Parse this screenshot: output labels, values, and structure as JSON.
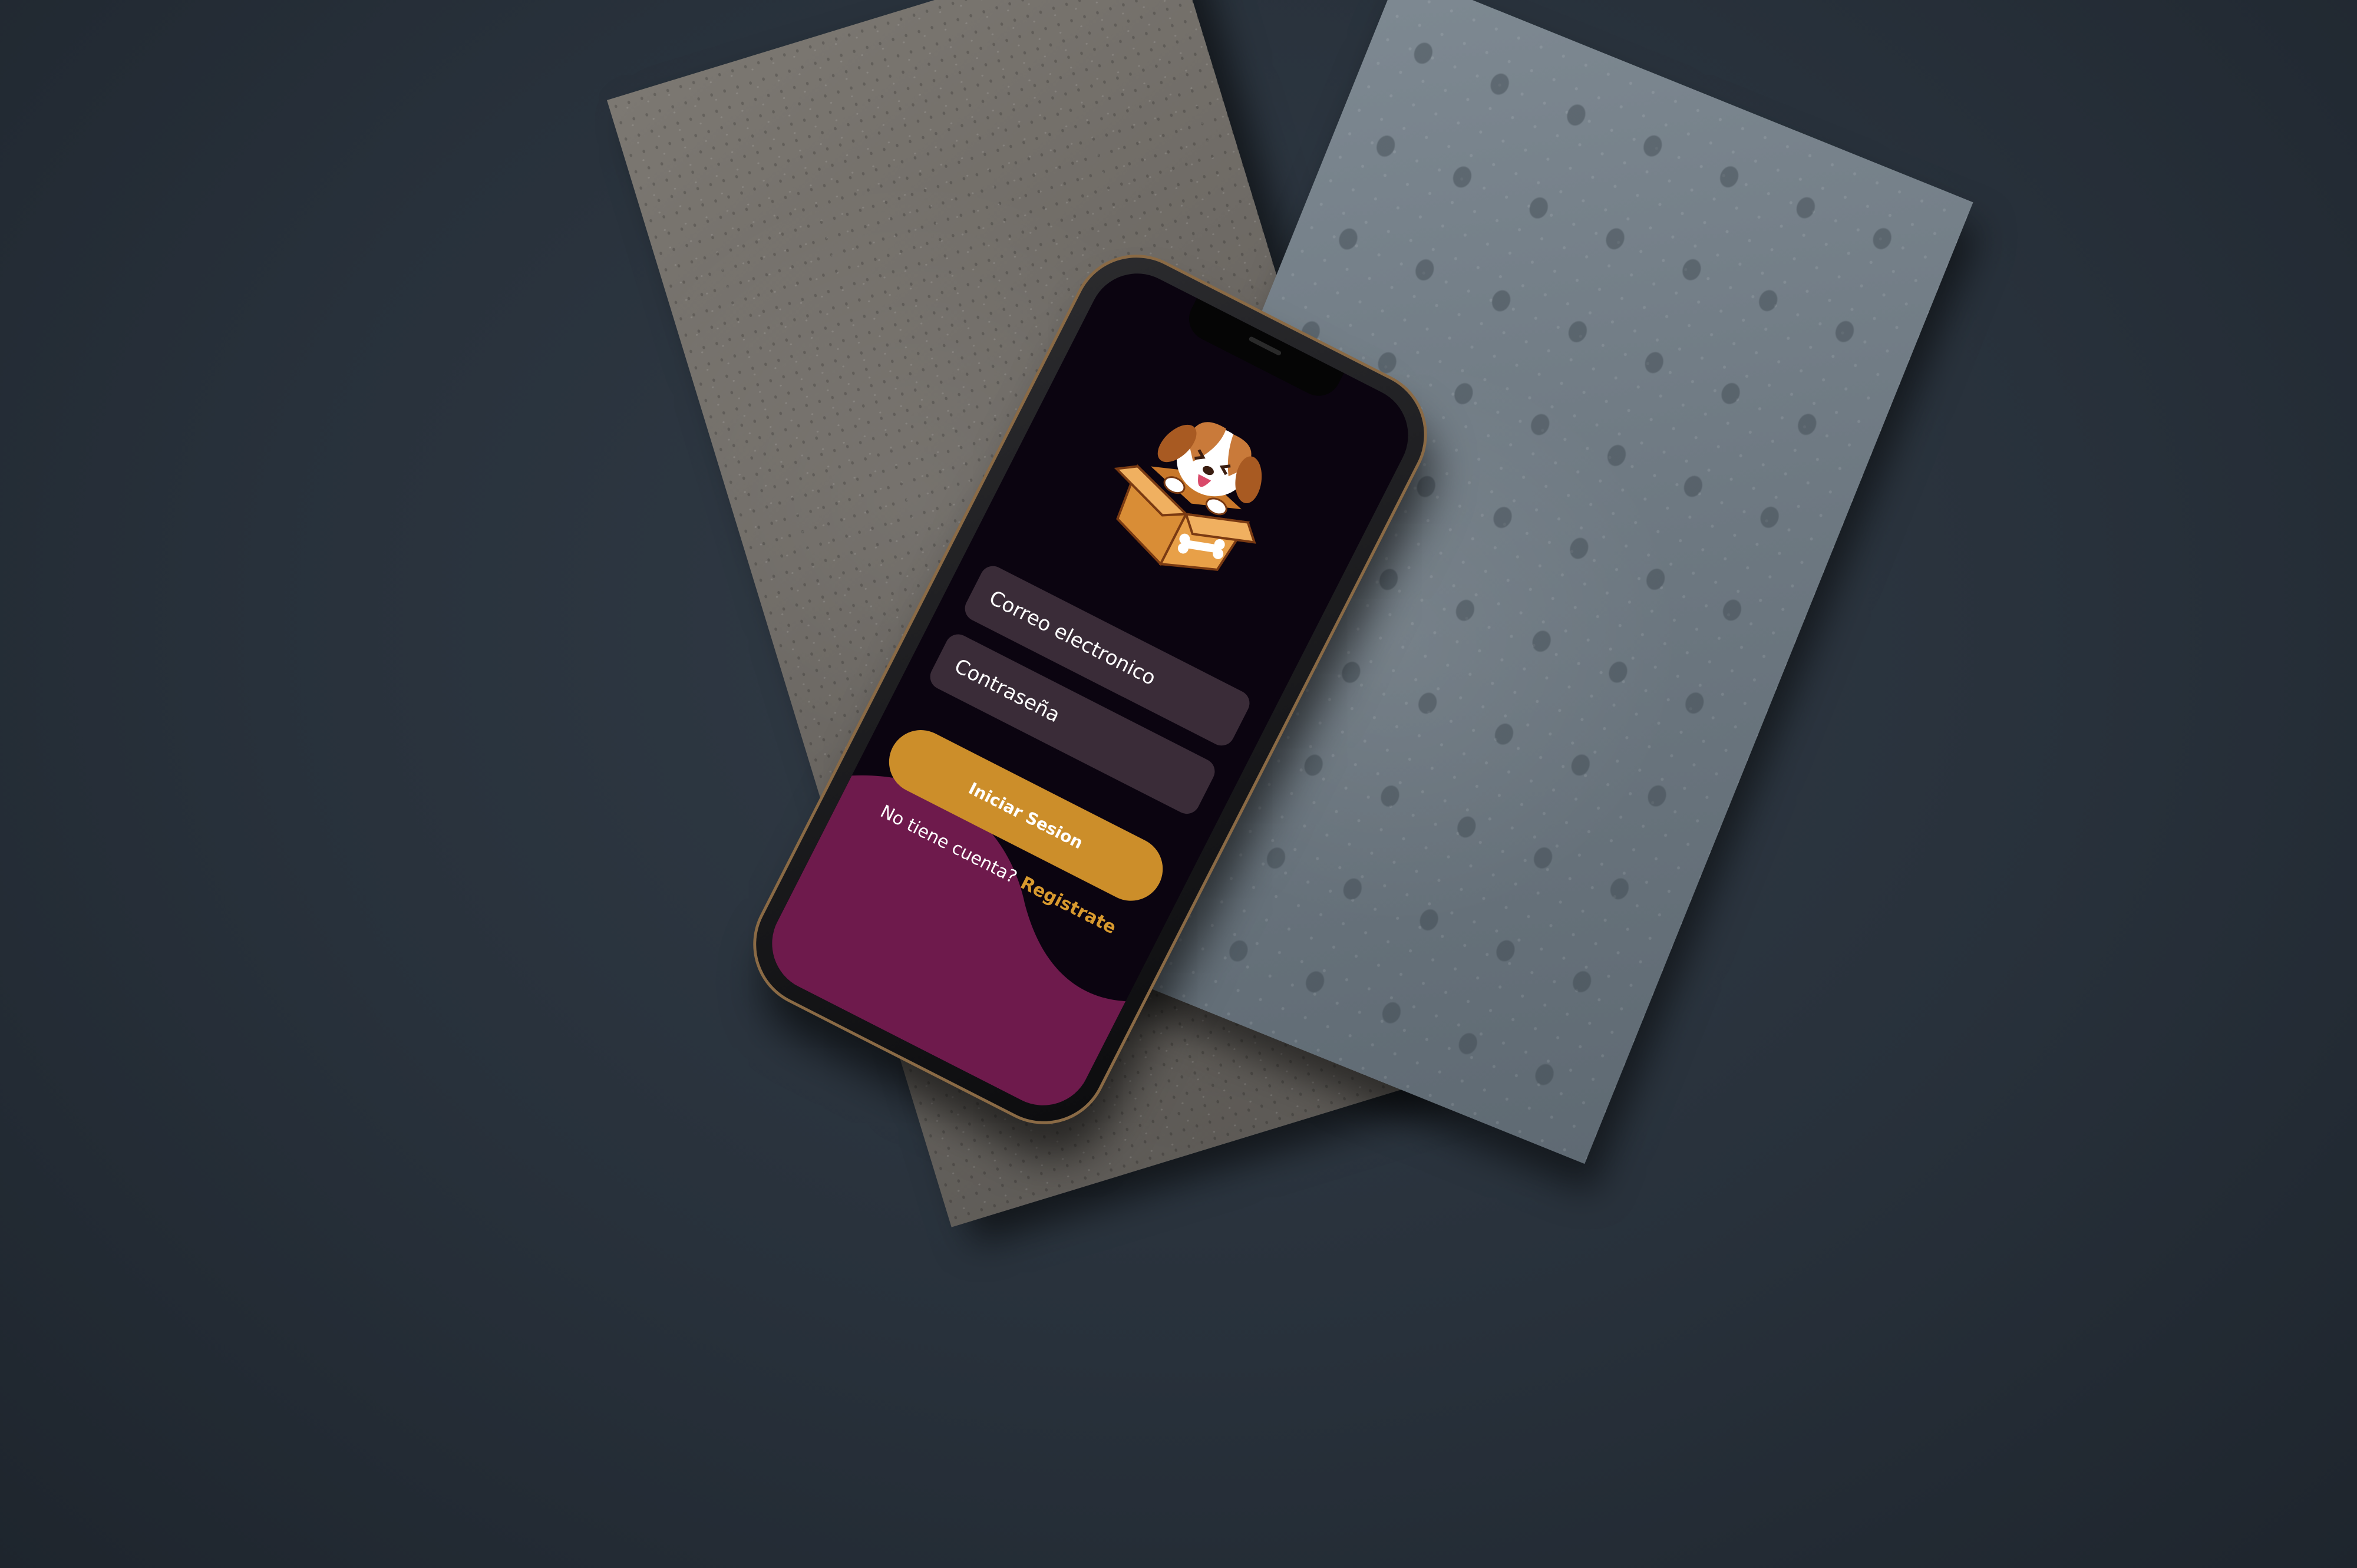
{
  "login": {
    "email_placeholder": "Correo electronico",
    "password_placeholder": "Contraseña",
    "submit_label": "Iniciar Sesion",
    "no_account_text": "No tiene cuenta?",
    "register_link": "Registrate"
  },
  "logo": {
    "icon": "puppy-in-box-icon"
  },
  "colors": {
    "screen_background": "#0b0410",
    "input_background": "#3a2c38",
    "accent_button": "#cc8e2a",
    "register_link": "#d89a2e",
    "wave": "#6e1a4c"
  }
}
